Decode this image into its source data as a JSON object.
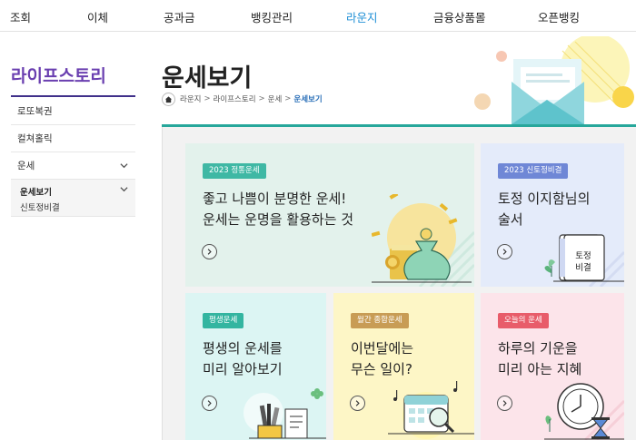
{
  "topnav": {
    "items": [
      "조회",
      "이체",
      "공과금",
      "뱅킹관리",
      "라운지",
      "금융상품몰",
      "오픈뱅킹"
    ],
    "active_index": 4,
    "active_color": "#1e8fd6"
  },
  "sidebar": {
    "title": "라이프스토리",
    "items": [
      {
        "label": "로또복권"
      },
      {
        "label": "컬쳐홀릭"
      },
      {
        "label": "운세"
      }
    ],
    "subitems": [
      {
        "label": "운세보기",
        "active": true
      },
      {
        "label": "신토정비결",
        "active": false
      }
    ]
  },
  "main": {
    "title": "운세보기",
    "breadcrumb": [
      "라운지",
      "라이프스토리",
      "운세",
      "운세보기"
    ]
  },
  "cards": [
    {
      "badge": "2023 정통운세",
      "text": "좋고 나쁨이 분명한 운세!\n운세는 운명을 활용하는 것",
      "bg": "#e3f2ec",
      "badge_color": "#3fb8a4",
      "icon": "money-bag-icon"
    },
    {
      "badge": "2023 신토정비결",
      "text": "토정 이지함님의\n술서",
      "bg": "#e4ebfa",
      "badge_color": "#6f87d6",
      "icon": "book-icon",
      "book_text": "토정\n비결"
    },
    {
      "badge": "평생운세",
      "text": "평생의 운세를\n미리 알아보기",
      "bg": "#dcf5f3",
      "badge_color": "#33b5a0",
      "icon": "pencil-cup-icon"
    },
    {
      "badge": "월간 종합운세",
      "text": "이번달에는\n무슨 일이?",
      "bg": "#fdf6c6",
      "badge_color": "#c89c55",
      "icon": "calendar-icon"
    },
    {
      "badge": "오늘의 운세",
      "text": "하루의 기운을\n미리 아는 지혜",
      "bg": "#fce4ea",
      "badge_color": "#e85c6a",
      "icon": "clock-icon"
    }
  ]
}
